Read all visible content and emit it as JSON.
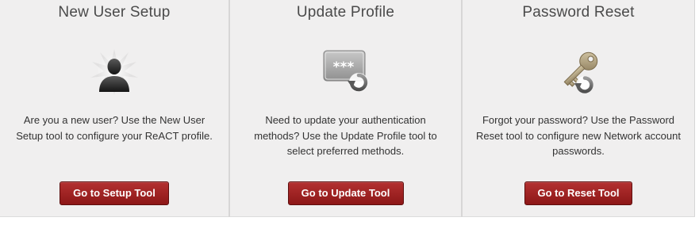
{
  "colors": {
    "panel_bg": "#f0efef",
    "button_bg": "#9f2323",
    "title_text": "#4a4a4a",
    "body_text": "#333333"
  },
  "panels": [
    {
      "title": "New User Setup",
      "icon": "user-silhouette-icon",
      "description": [
        "Are you a new user? Use the New User",
        "Setup tool to configure your ReACT profile."
      ],
      "button": "Go to Setup Tool"
    },
    {
      "title": "Update Profile",
      "icon": "password-field-refresh-icon",
      "description": [
        "Need to update your authentication",
        "methods? Use the Update Profile tool to",
        "select preferred methods."
      ],
      "button": "Go to Update Tool"
    },
    {
      "title": "Password Reset",
      "icon": "key-refresh-icon",
      "description": [
        "Forgot your password? Use the Password",
        "Reset tool to configure new Network account",
        "passwords."
      ],
      "button": "Go to Reset Tool"
    }
  ]
}
